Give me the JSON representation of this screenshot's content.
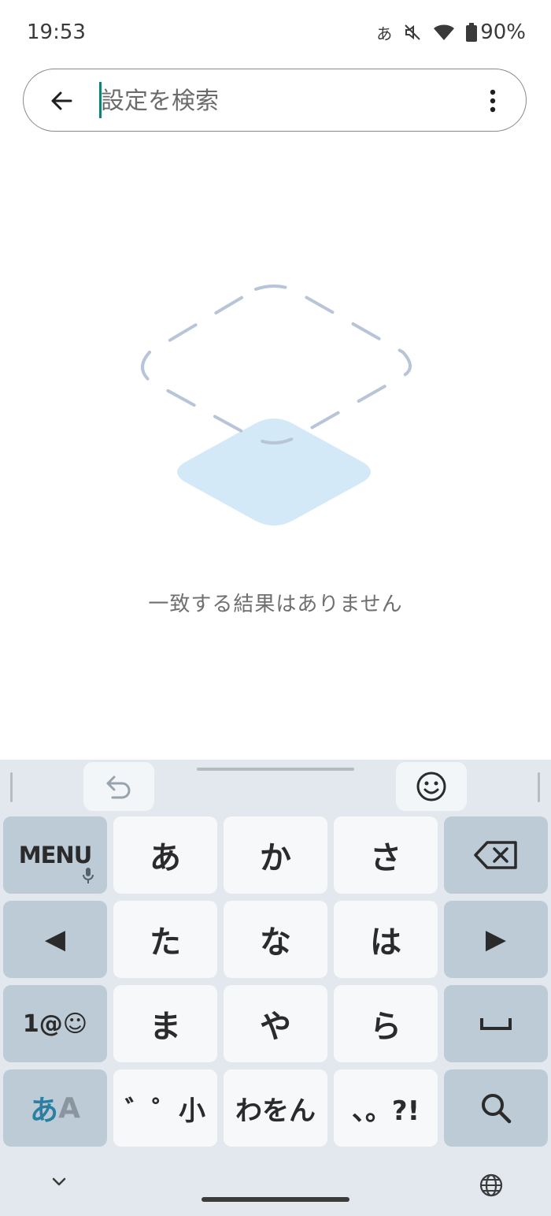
{
  "status_bar": {
    "time": "19:53",
    "ime_indicator": "あ",
    "battery": "90%",
    "icons": [
      "mute-icon",
      "wifi-icon",
      "battery-icon"
    ]
  },
  "search": {
    "placeholder": "設定を検索",
    "value": "",
    "icons": [
      "back-arrow-icon",
      "more-vert-icon"
    ]
  },
  "empty_state": {
    "message": "一致する結果はありません"
  },
  "keyboard": {
    "toolbar": {
      "icons": [
        "undo-icon",
        "emoji-icon"
      ]
    },
    "rows": [
      [
        "MENU",
        "あ",
        "か",
        "さ",
        "backspace"
      ],
      [
        "◀",
        "た",
        "な",
        "は",
        "▶"
      ],
      [
        "1@☺",
        "ま",
        "や",
        "ら",
        "space"
      ],
      [
        "あA",
        "゛゜小",
        "わをん",
        "、。?!",
        "search"
      ]
    ],
    "keys": {
      "menu": "MENU",
      "a": "あ",
      "ka": "か",
      "sa": "さ",
      "left": "◀",
      "ta": "た",
      "na": "な",
      "ha": "は",
      "right": "▶",
      "symbols": "1@☺",
      "ma": "ま",
      "ya": "や",
      "ra": "ら",
      "mode_a": "あ",
      "mode_b": "A",
      "dakuten": "゛゜小",
      "wa": "わをん",
      "punct": "、。?!"
    },
    "bottom_icons": [
      "chevron-down-icon",
      "globe-icon"
    ]
  },
  "colors": {
    "accent": "#1a7f72",
    "keyboard_bg": "#e2e8ee",
    "func_key": "#bccbd6",
    "char_key": "#f6f8fa",
    "illustration_fill": "#d3e9f8",
    "illustration_dash": "#b8c4d8",
    "mode_key_accent": "#2a7fa3"
  }
}
